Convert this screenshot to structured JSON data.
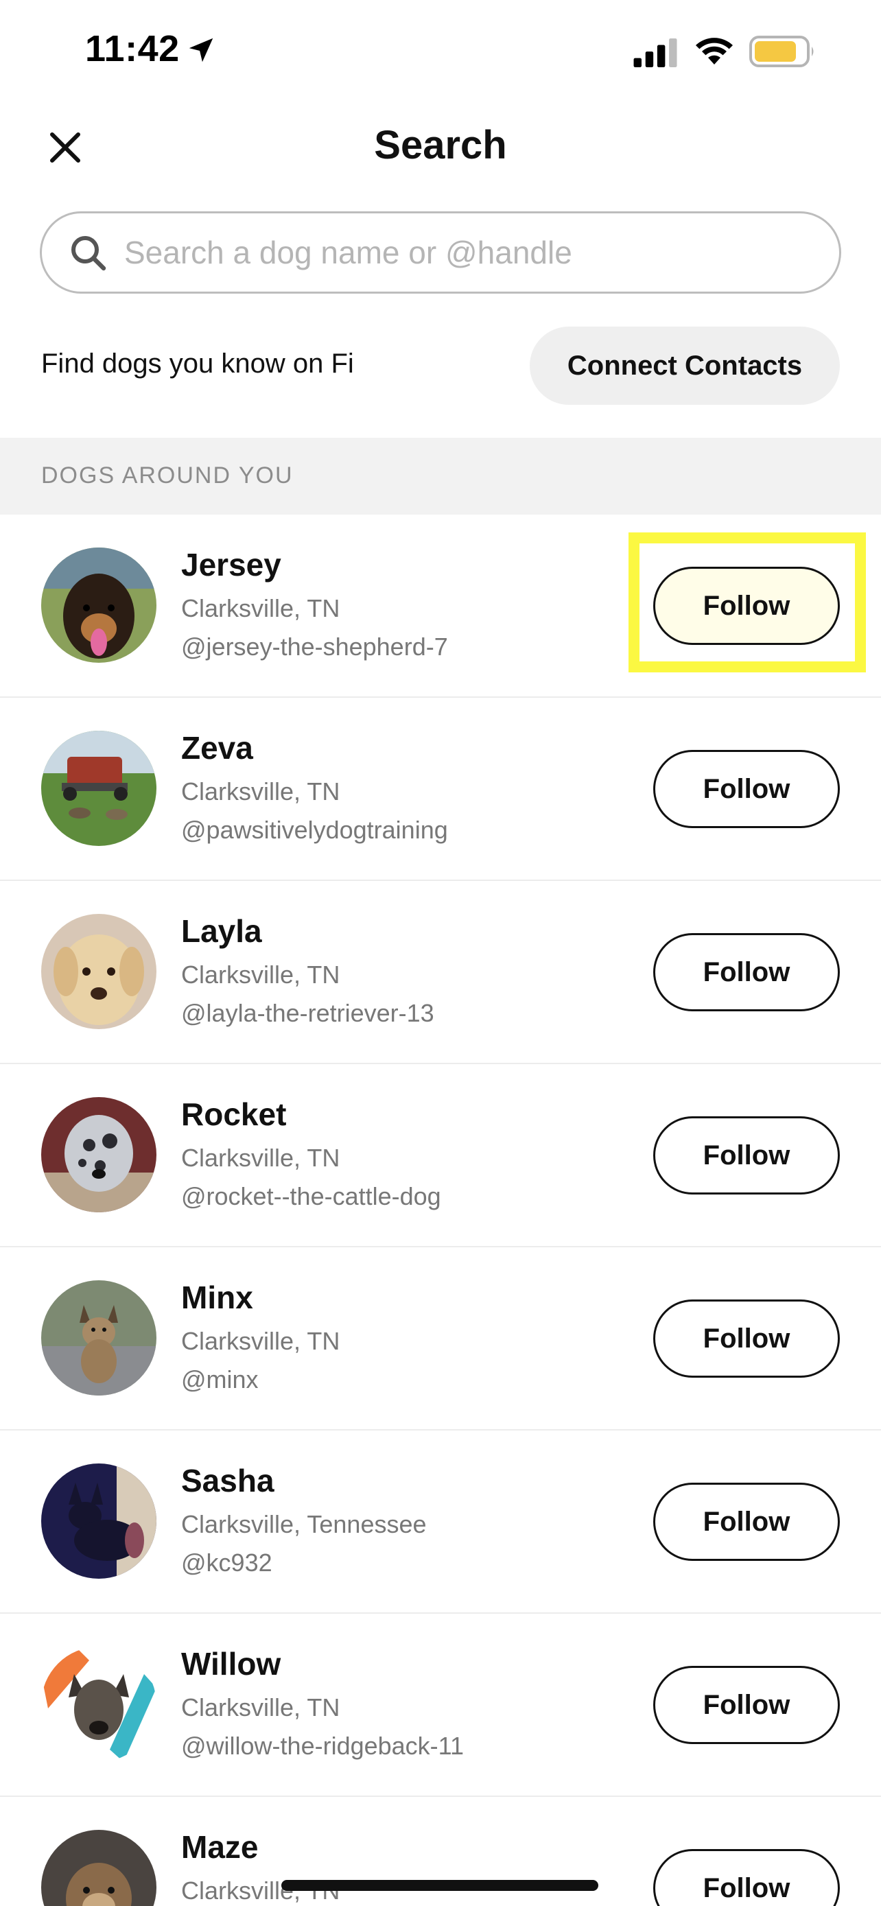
{
  "status_bar": {
    "time": "11:42"
  },
  "header": {
    "title": "Search"
  },
  "search": {
    "placeholder": "Search a dog name or @handle",
    "value": ""
  },
  "find_row": {
    "text": "Find dogs you know on Fi",
    "button_label": "Connect Contacts"
  },
  "section": {
    "label": "DOGS AROUND YOU"
  },
  "dogs": [
    {
      "name": "Jersey",
      "location": "Clarksville, TN",
      "handle": "@jersey-the-shepherd-7",
      "button": "Follow"
    },
    {
      "name": "Zeva",
      "location": "Clarksville, TN",
      "handle": "@pawsitivelydogtraining",
      "button": "Follow"
    },
    {
      "name": "Layla",
      "location": "Clarksville, TN",
      "handle": "@layla-the-retriever-13",
      "button": "Follow"
    },
    {
      "name": "Rocket",
      "location": "Clarksville, TN",
      "handle": "@rocket--the-cattle-dog",
      "button": "Follow"
    },
    {
      "name": "Minx",
      "location": "Clarksville, TN",
      "handle": "@minx",
      "button": "Follow"
    },
    {
      "name": "Sasha",
      "location": "Clarksville, Tennessee",
      "handle": "@kc932",
      "button": "Follow"
    },
    {
      "name": "Willow",
      "location": "Clarksville, TN",
      "handle": "@willow-the-ridgeback-11",
      "button": "Follow"
    },
    {
      "name": "Maze",
      "location": "Clarksville, TN",
      "handle": "",
      "button": "Follow"
    }
  ],
  "colors": {
    "highlight": "#fbf842",
    "battery": "#f5c842",
    "placeholder": "#b5b5b5",
    "secondary_text": "#777777"
  }
}
